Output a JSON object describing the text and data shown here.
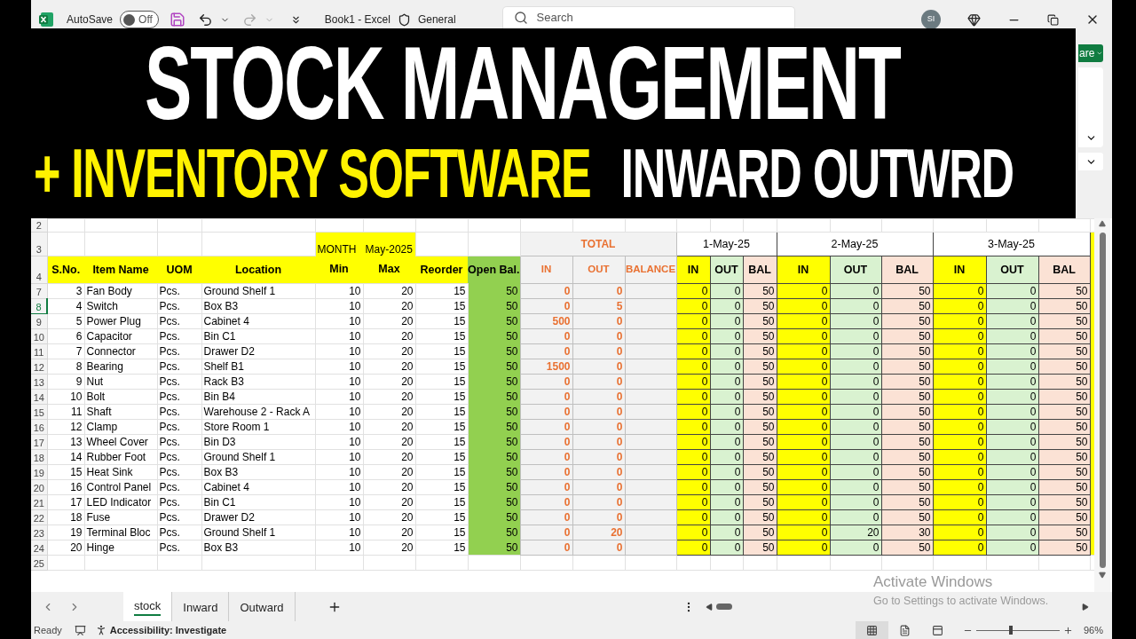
{
  "title_bar": {
    "autosave_label": "AutoSave",
    "autosave_on": false,
    "autosave_state": "Off",
    "document": "Book1",
    "separator": "-",
    "app": "Excel",
    "sensitivity": "General",
    "search_placeholder": "Search",
    "avatar": "SI"
  },
  "banner": {
    "line1": "STOCK MANAGEMENT",
    "line2_highlight": "+ INVENTORY SOFTWARE",
    "line2": "INWARD OUTWRD"
  },
  "share_button": "are",
  "sheet": {
    "top_rows": [
      "2",
      "3",
      "4"
    ],
    "month_label": "MONTH",
    "month": "May-2025",
    "total_label": "TOTAL",
    "columns": [
      "S.No.",
      "Item Name",
      "UOM",
      "Location",
      "Min",
      "Max",
      "Reorder",
      "Open Bal."
    ],
    "total_columns": [
      "IN",
      "OUT",
      "BALANCE"
    ],
    "days": [
      {
        "date": "1-May-25",
        "columns": [
          "IN",
          "OUT",
          "BAL"
        ]
      },
      {
        "date": "2-May-25",
        "columns": [
          "IN",
          "OUT",
          "BAL"
        ]
      },
      {
        "date": "3-May-25",
        "columns": [
          "IN",
          "OUT",
          "BAL"
        ]
      }
    ],
    "rows": [
      {
        "row": "7",
        "selected": false,
        "cells": [
          "3",
          "Fan Body",
          "Pcs.",
          "Ground Shelf 1",
          "10",
          "20",
          "15",
          "50"
        ],
        "in": "0",
        "out": "0",
        "days": [
          [
            "0",
            "0",
            "50"
          ],
          [
            "0",
            "0",
            "50"
          ],
          [
            "0",
            "0",
            "50"
          ]
        ]
      },
      {
        "row": "8",
        "selected": true,
        "cells": [
          "4",
          "Switch",
          "Pcs.",
          "Box B3",
          "10",
          "20",
          "15",
          "50"
        ],
        "in": "0",
        "out": "5",
        "days": [
          [
            "0",
            "0",
            "50"
          ],
          [
            "0",
            "0",
            "50"
          ],
          [
            "0",
            "0",
            "50"
          ]
        ]
      },
      {
        "row": "9",
        "selected": false,
        "cells": [
          "5",
          "Power Plug",
          "Pcs.",
          "Cabinet 4",
          "10",
          "20",
          "15",
          "50"
        ],
        "in": "500",
        "out": "0",
        "days": [
          [
            "0",
            "0",
            "50"
          ],
          [
            "0",
            "0",
            "50"
          ],
          [
            "0",
            "0",
            "50"
          ]
        ]
      },
      {
        "row": "10",
        "selected": false,
        "cells": [
          "6",
          "Capacitor",
          "Pcs.",
          "Bin C1",
          "10",
          "20",
          "15",
          "50"
        ],
        "in": "0",
        "out": "0",
        "days": [
          [
            "0",
            "0",
            "50"
          ],
          [
            "0",
            "0",
            "50"
          ],
          [
            "0",
            "0",
            "50"
          ]
        ]
      },
      {
        "row": "11",
        "selected": false,
        "cells": [
          "7",
          "Connector",
          "Pcs.",
          "Drawer D2",
          "10",
          "20",
          "15",
          "50"
        ],
        "in": "0",
        "out": "0",
        "days": [
          [
            "0",
            "0",
            "50"
          ],
          [
            "0",
            "0",
            "50"
          ],
          [
            "0",
            "0",
            "50"
          ]
        ]
      },
      {
        "row": "12",
        "selected": false,
        "cells": [
          "8",
          "Bearing",
          "Pcs.",
          "Shelf B1",
          "10",
          "20",
          "15",
          "50"
        ],
        "in": "1500",
        "out": "0",
        "days": [
          [
            "0",
            "0",
            "50"
          ],
          [
            "0",
            "0",
            "50"
          ],
          [
            "0",
            "0",
            "50"
          ]
        ]
      },
      {
        "row": "13",
        "selected": false,
        "cells": [
          "9",
          "Nut",
          "Pcs.",
          "Rack B3",
          "10",
          "20",
          "15",
          "50"
        ],
        "in": "0",
        "out": "0",
        "days": [
          [
            "0",
            "0",
            "50"
          ],
          [
            "0",
            "0",
            "50"
          ],
          [
            "0",
            "0",
            "50"
          ]
        ]
      },
      {
        "row": "14",
        "selected": false,
        "cells": [
          "10",
          "Bolt",
          "Pcs.",
          "Bin B4",
          "10",
          "20",
          "15",
          "50"
        ],
        "in": "0",
        "out": "0",
        "days": [
          [
            "0",
            "0",
            "50"
          ],
          [
            "0",
            "0",
            "50"
          ],
          [
            "0",
            "0",
            "50"
          ]
        ]
      },
      {
        "row": "15",
        "selected": false,
        "cells": [
          "11",
          "Shaft",
          "Pcs.",
          "Warehouse 2 - Rack A",
          "10",
          "20",
          "15",
          "50"
        ],
        "in": "0",
        "out": "0",
        "days": [
          [
            "0",
            "0",
            "50"
          ],
          [
            "0",
            "0",
            "50"
          ],
          [
            "0",
            "0",
            "50"
          ]
        ]
      },
      {
        "row": "16",
        "selected": false,
        "cells": [
          "12",
          "Clamp",
          "Pcs.",
          "Store Room 1",
          "10",
          "20",
          "15",
          "50"
        ],
        "in": "0",
        "out": "0",
        "days": [
          [
            "0",
            "0",
            "50"
          ],
          [
            "0",
            "0",
            "50"
          ],
          [
            "0",
            "0",
            "50"
          ]
        ]
      },
      {
        "row": "17",
        "selected": false,
        "cells": [
          "13",
          "Wheel Cover",
          "Pcs.",
          "Bin D3",
          "10",
          "20",
          "15",
          "50"
        ],
        "in": "0",
        "out": "0",
        "days": [
          [
            "0",
            "0",
            "50"
          ],
          [
            "0",
            "0",
            "50"
          ],
          [
            "0",
            "0",
            "50"
          ]
        ]
      },
      {
        "row": "18",
        "selected": false,
        "cells": [
          "14",
          "Rubber Foot",
          "Pcs.",
          "Ground Shelf 1",
          "10",
          "20",
          "15",
          "50"
        ],
        "in": "0",
        "out": "0",
        "days": [
          [
            "0",
            "0",
            "50"
          ],
          [
            "0",
            "0",
            "50"
          ],
          [
            "0",
            "0",
            "50"
          ]
        ]
      },
      {
        "row": "19",
        "selected": false,
        "cells": [
          "15",
          "Heat Sink",
          "Pcs.",
          "Box B3",
          "10",
          "20",
          "15",
          "50"
        ],
        "in": "0",
        "out": "0",
        "days": [
          [
            "0",
            "0",
            "50"
          ],
          [
            "0",
            "0",
            "50"
          ],
          [
            "0",
            "0",
            "50"
          ]
        ]
      },
      {
        "row": "20",
        "selected": false,
        "cells": [
          "16",
          "Control Panel",
          "Pcs.",
          "Cabinet 4",
          "10",
          "20",
          "15",
          "50"
        ],
        "in": "0",
        "out": "0",
        "days": [
          [
            "0",
            "0",
            "50"
          ],
          [
            "0",
            "0",
            "50"
          ],
          [
            "0",
            "0",
            "50"
          ]
        ]
      },
      {
        "row": "21",
        "selected": false,
        "cells": [
          "17",
          "LED Indicator",
          "Pcs.",
          "Bin C1",
          "10",
          "20",
          "15",
          "50"
        ],
        "in": "0",
        "out": "0",
        "days": [
          [
            "0",
            "0",
            "50"
          ],
          [
            "0",
            "0",
            "50"
          ],
          [
            "0",
            "0",
            "50"
          ]
        ]
      },
      {
        "row": "22",
        "selected": false,
        "cells": [
          "18",
          "Fuse",
          "Pcs.",
          "Drawer D2",
          "10",
          "20",
          "15",
          "50"
        ],
        "in": "0",
        "out": "0",
        "days": [
          [
            "0",
            "0",
            "50"
          ],
          [
            "0",
            "0",
            "50"
          ],
          [
            "0",
            "0",
            "50"
          ]
        ]
      },
      {
        "row": "23",
        "selected": false,
        "cells": [
          "19",
          "Terminal Bloc",
          "Pcs.",
          "Ground Shelf 1",
          "10",
          "20",
          "15",
          "50"
        ],
        "in": "0",
        "out": "20",
        "days": [
          [
            "0",
            "0",
            "50"
          ],
          [
            "0",
            "20",
            "30"
          ],
          [
            "0",
            "0",
            "50"
          ]
        ]
      },
      {
        "row": "24",
        "selected": false,
        "cells": [
          "20",
          "Hinge",
          "Pcs.",
          "Box B3",
          "10",
          "20",
          "15",
          "50"
        ],
        "in": "0",
        "out": "0",
        "days": [
          [
            "0",
            "0",
            "50"
          ],
          [
            "0",
            "0",
            "50"
          ],
          [
            "0",
            "0",
            "50"
          ]
        ]
      }
    ],
    "empty_rows": [
      "25"
    ]
  },
  "tabs": [
    {
      "label": "stock",
      "selected": true
    },
    {
      "label": "Inward",
      "selected": false
    },
    {
      "label": "Outward",
      "selected": false
    }
  ],
  "watermark": {
    "title": "Activate Windows",
    "subtitle": "Go to Settings to activate Windows."
  },
  "status_bar": {
    "status": "Ready",
    "accessibility": "Accessibility: Investigate",
    "views": [
      {
        "kind": "normal",
        "selected": true
      },
      {
        "kind": "page_layout",
        "selected": false
      },
      {
        "kind": "page_break",
        "selected": false
      }
    ],
    "zoom": {
      "level": 0.42,
      "reading": "96%"
    }
  }
}
